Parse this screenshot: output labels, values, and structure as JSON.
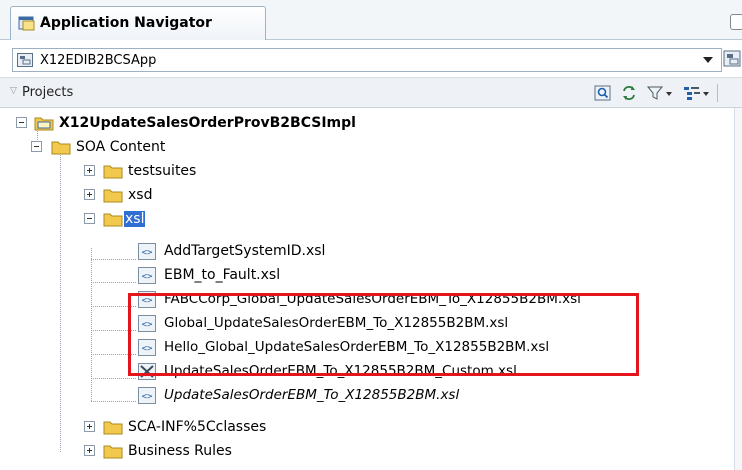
{
  "navigator": {
    "tab_title": "Application Navigator",
    "application": "X12EDIB2BCSApp",
    "projects_label": "Projects"
  },
  "tree": {
    "project": "X12UpdateSalesOrderProvB2BCSImpl",
    "soa_content": "SOA Content",
    "testsuites": "testsuites",
    "xsd": "xsd",
    "xsl": "xsl",
    "xsl_files": [
      "AddTargetSystemID.xsl",
      "EBM_to_Fault.xsl",
      "FABCCorp_Global_UpdateSalesOrderEBM_To_X12855B2BM.xsl",
      "Global_UpdateSalesOrderEBM_To_X12855B2BM.xsl",
      "Hello_Global_UpdateSalesOrderEBM_To_X12855B2BM.xsl",
      "UpdateSalesOrderEBM_To_X12855B2BM_Custom.xsl",
      "UpdateSalesOrderEBM_To_X12855B2BM.xsl"
    ],
    "sca_inf": "SCA-INF%5Cclasses",
    "business_rules": "Business Rules"
  },
  "colors": {
    "highlight": "#e3141c",
    "selection": "#2f6fd1",
    "folder": "#f2c94c"
  }
}
